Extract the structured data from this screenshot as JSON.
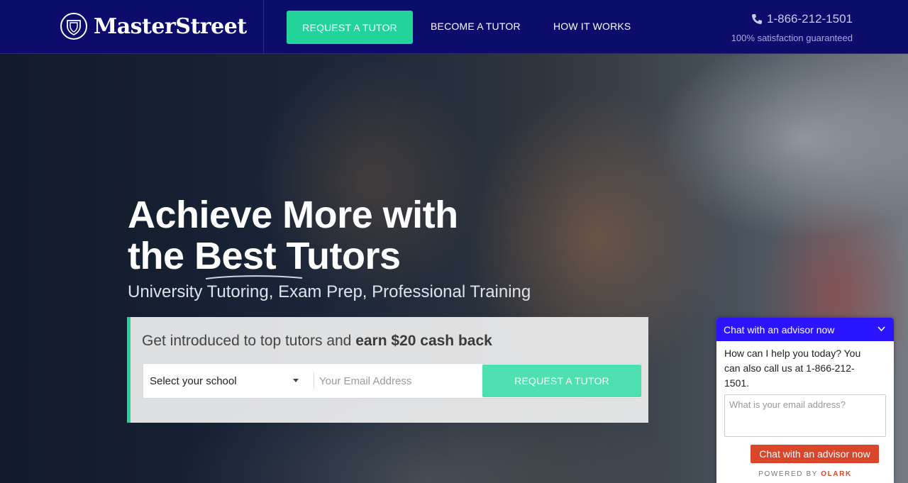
{
  "nav": {
    "brand": "MasterStreet",
    "cta_label": "REQUEST A TUTOR",
    "links": [
      "BECOME A TUTOR",
      "HOW IT WORKS"
    ],
    "phone": "1-866-212-1501",
    "guarantee": "100% satisfaction guaranteed"
  },
  "hero": {
    "headline_line1": "Achieve More with",
    "headline_line2": "the Best Tutors",
    "subheadline": "University Tutoring, Exam Prep, Professional Training"
  },
  "signup": {
    "title_prefix": "Get introduced to top tutors and ",
    "title_bold": "earn $20 cash back",
    "school_select_value": "Select your school",
    "email_placeholder": "Your Email Address",
    "submit_label": "REQUEST A TUTOR"
  },
  "chat": {
    "header": "Chat with an advisor now",
    "message": "How can I help you today? You can also call us at 1-866-212-1501.",
    "email_placeholder": "What is your email address?",
    "button_label": "Chat with an advisor now",
    "powered_prefix": "POWERED BY ",
    "powered_brand": "OLARK"
  },
  "colors": {
    "nav_bg": "#0c0c6c",
    "accent_green": "#22d39a",
    "chat_header": "#2b14ff",
    "chat_button": "#d9462a"
  }
}
